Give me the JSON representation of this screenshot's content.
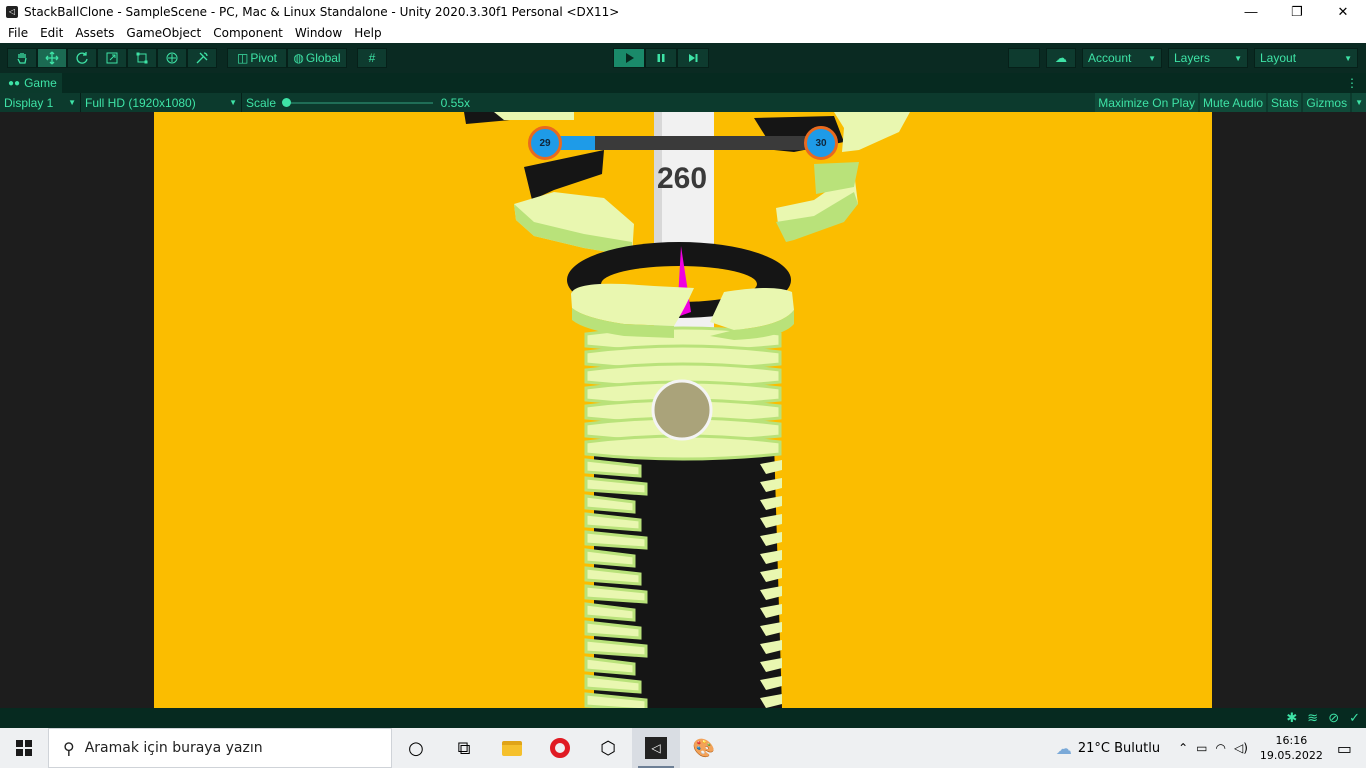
{
  "window": {
    "title": "StackBallClone - SampleScene - PC, Mac & Linux Standalone - Unity 2020.3.30f1 Personal <DX11>",
    "minimize": "—",
    "maximize": "❐",
    "close": "✕"
  },
  "menu": [
    "File",
    "Edit",
    "Assets",
    "GameObject",
    "Component",
    "Window",
    "Help"
  ],
  "toolbar": {
    "pivot_label": "Pivot",
    "global_label": "Global",
    "account_label": "Account",
    "layers_label": "Layers",
    "layout_label": "Layout"
  },
  "game_tab": {
    "label": "Game",
    "display": "Display 1",
    "resolution": "Full HD (1920x1080)",
    "scale_label": "Scale",
    "scale_value": "0.55x",
    "scale_fraction": 0.0,
    "maximize_on_play": "Maximize On Play",
    "mute_audio": "Mute Audio",
    "stats": "Stats",
    "gizmos": "Gizmos"
  },
  "game": {
    "level_current": "29",
    "level_next": "30",
    "level_progress": 0.17,
    "score": "260",
    "colors": {
      "background": "#fbbd00",
      "ring": "#e9f7b0",
      "ring_side": "#b9e27a",
      "danger": "#151515",
      "pole": "#f1f1f1",
      "fire": "#f000e0",
      "progress_fill": "#1e9be8",
      "level_badge": "#1e9be8",
      "level_ring": "#e86a1f"
    }
  },
  "taskbar": {
    "search_placeholder": "Aramak için buraya yazın",
    "weather": "21°C  Bulutlu",
    "time": "16:16",
    "date": "19.05.2022"
  }
}
